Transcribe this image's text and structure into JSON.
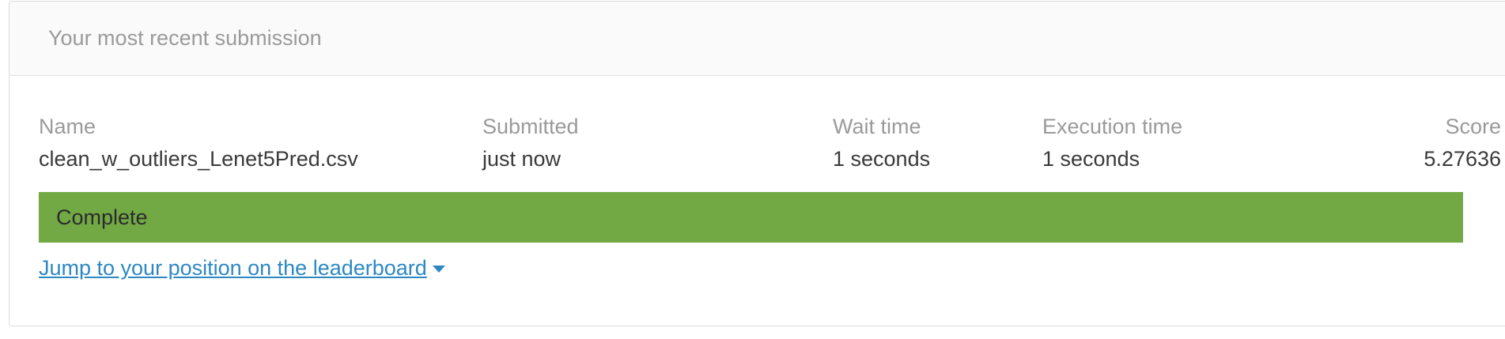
{
  "panel": {
    "title": "Your most recent submission"
  },
  "submission": {
    "columns": {
      "name_header": "Name",
      "submitted_header": "Submitted",
      "wait_header": "Wait time",
      "exec_header": "Execution time",
      "score_header": "Score"
    },
    "name": "clean_w_outliers_Lenet5Pred.csv",
    "submitted": "just now",
    "wait_time": "1 seconds",
    "execution_time": "1 seconds",
    "score": "5.27636"
  },
  "status": {
    "label": "Complete",
    "color": "#72a945"
  },
  "leaderboard_link": {
    "label": "Jump to your position on the leaderboard ",
    "color": "#2d88c2",
    "icon": "caret-down-icon"
  }
}
